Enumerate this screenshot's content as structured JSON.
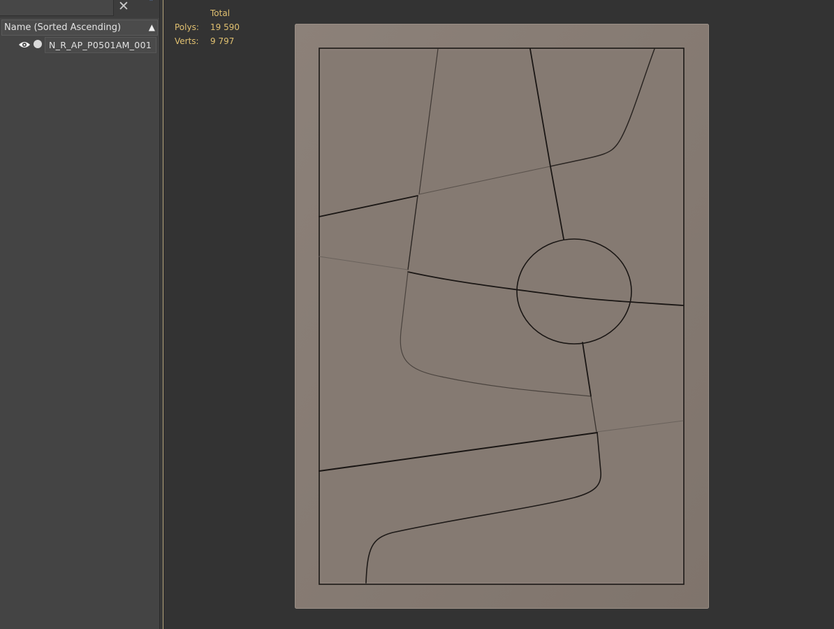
{
  "explorer": {
    "close_glyph": "✕",
    "expand_glyph": "»",
    "column_header": "Name (Sorted Ascending)",
    "sort_indicator": "▲",
    "objects": [
      {
        "name": "N_R_AP_P0501AM_001",
        "visible_icon": "eye-icon",
        "render_icon": "dot-icon"
      }
    ]
  },
  "viewport": {
    "stats": {
      "header": "Total",
      "polys_label": "Polys:",
      "polys_value": "19 590",
      "verts_label": "Verts:",
      "verts_value": "9 797"
    }
  },
  "colors": {
    "panel_bg": "#444444",
    "viewport_bg": "#333333",
    "stats_text": "#e0c070",
    "model_surface": "#857a72",
    "groove": "#1e1a18"
  }
}
